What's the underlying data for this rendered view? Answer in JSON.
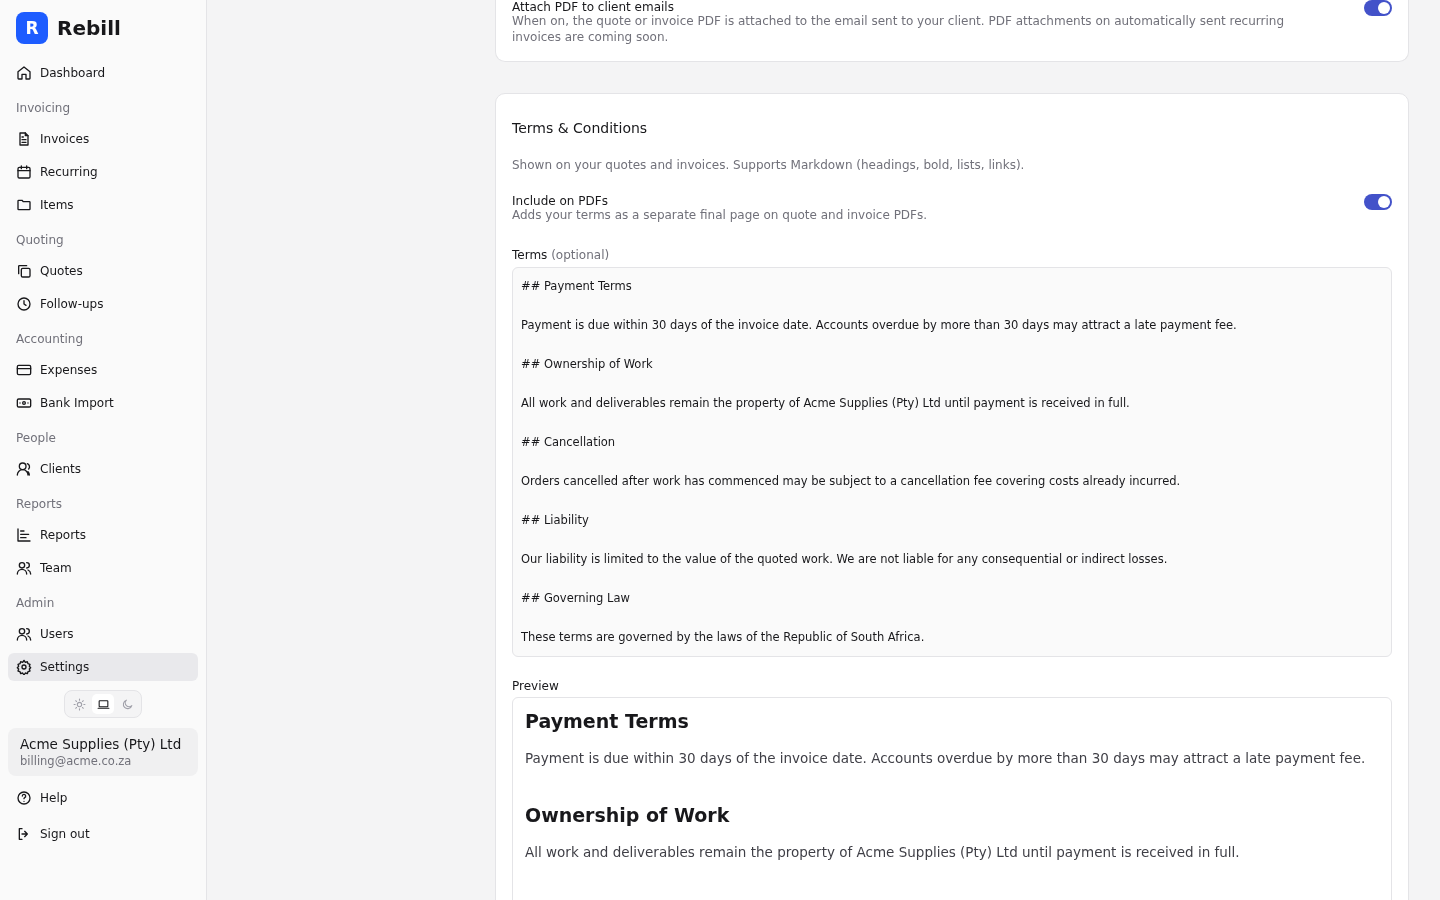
{
  "brand": {
    "logo_letter": "R",
    "name": "Rebill"
  },
  "nav": [
    {
      "items": [
        {
          "label": "Dashboard",
          "selected": false
        }
      ]
    },
    {
      "heading": "Invoicing",
      "items": [
        {
          "label": "Invoices",
          "selected": false
        },
        {
          "label": "Recurring",
          "selected": false
        },
        {
          "label": "Items",
          "selected": false
        }
      ]
    },
    {
      "heading": "Quoting",
      "items": [
        {
          "label": "Quotes",
          "selected": false
        },
        {
          "label": "Follow-ups",
          "selected": false
        }
      ]
    },
    {
      "heading": "Accounting",
      "items": [
        {
          "label": "Expenses",
          "selected": false
        },
        {
          "label": "Bank Import",
          "selected": false
        }
      ]
    },
    {
      "heading": "People",
      "items": [
        {
          "label": "Clients",
          "selected": false
        }
      ]
    },
    {
      "heading": "Reports",
      "items": [
        {
          "label": "Reports",
          "selected": false
        },
        {
          "label": "Team",
          "selected": false
        }
      ]
    },
    {
      "heading": "Admin",
      "items": [
        {
          "label": "Users",
          "selected": false
        },
        {
          "label": "Settings",
          "selected": true
        }
      ]
    }
  ],
  "theme_options": [
    {
      "kind": "light",
      "selected": false
    },
    {
      "kind": "system",
      "selected": true
    },
    {
      "kind": "dark",
      "selected": false
    }
  ],
  "account": {
    "name": "Acme Supplies (Pty) Ltd",
    "email": "billing@acme.co.za"
  },
  "footer_links": [
    {
      "label": "Help"
    },
    {
      "label": "Sign out"
    }
  ],
  "email_card": {
    "setting": {
      "label": "Attach PDF to client emails",
      "description": "When on, the quote or invoice PDF is attached to the email sent to your client. PDF attachments on automatically sent recurring invoices are coming soon.",
      "on": true
    }
  },
  "terms_card": {
    "title": "Terms & Conditions",
    "description": "Shown on your quotes and invoices. Supports Markdown (headings, bold, lists, links).",
    "setting": {
      "label": "Include on PDFs",
      "description": "Adds your terms as a separate final page on quote and invoice PDFs.",
      "on": true
    },
    "terms_field": {
      "label": "Terms",
      "label_hint": "(optional)",
      "value": "## Payment Terms\n\nPayment is due within 30 days of the invoice date. Accounts overdue by more than 30 days may attract a late payment fee.\n\n## Ownership of Work\n\nAll work and deliverables remain the property of Acme Supplies (Pty) Ltd until payment is received in full.\n\n## Cancellation\n\nOrders cancelled after work has commenced may be subject to a cancellation fee covering costs already incurred.\n\n## Liability\n\nOur liability is limited to the value of the quoted work. We are not liable for any consequential or indirect losses.\n\n## Governing Law\n\nThese terms are governed by the laws of the Republic of South Africa."
    },
    "preview": {
      "label": "Preview",
      "blocks": [
        {
          "kind": "heading",
          "text": "Payment Terms"
        },
        {
          "kind": "paragraph",
          "text": "Payment is due within 30 days of the invoice date. Accounts overdue by more than 30 days may attract a late payment fee."
        },
        {
          "kind": "heading",
          "text": "Ownership of Work"
        },
        {
          "kind": "paragraph",
          "text": "All work and deliverables remain the property of Acme Supplies (Pty) Ltd until payment is received in full."
        }
      ]
    }
  }
}
